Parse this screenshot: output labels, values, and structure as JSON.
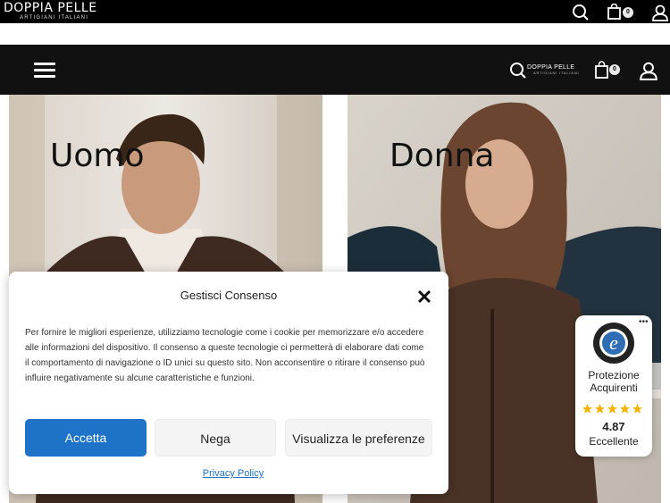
{
  "topbar": {
    "brand_name": "DOPPIA PELLE",
    "brand_tagline": "ARTIGIANI ITALIANI",
    "cart_count": "0"
  },
  "header": {
    "brand_name": "DOPPIA PELLE",
    "brand_tagline": "ARTIGIANI ITALIANI",
    "cart_count": "0"
  },
  "hero": {
    "left_title": "Uomo",
    "right_title": "Donna"
  },
  "consent": {
    "title": "Gestisci Consenso",
    "body": "Per fornire le migliori esperienze, utilizziamo tecnologie come i cookie per memorizzare e/o accedere alle informazioni del dispositivo. Il consenso a queste tecnologie ci permetterà di elaborare dati come il comportamento di navigazione o ID unici su questo sito. Non acconsentire o ritirare il consenso può influire negativamente su alcune caratteristiche e funzioni.",
    "accept_label": "Accetta",
    "deny_label": "Nega",
    "prefs_label": "Visualizza le preferenze",
    "privacy_label": "Privacy Policy"
  },
  "trusted_shops": {
    "label_line1": "Protezione",
    "label_line2": "Acquirenti",
    "rating": "4.87",
    "rating_text": "Eccellente",
    "stars": 5
  },
  "colors": {
    "accent": "#1e72c8",
    "header_bg": "#111111",
    "star": "#f5b300"
  }
}
